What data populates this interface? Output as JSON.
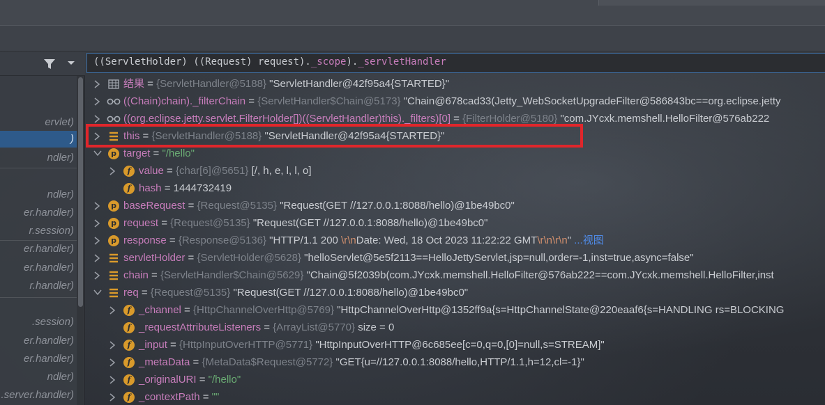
{
  "expression": {
    "part1": "((ServletHolder) ((Request) request).",
    "field1": "_scope",
    "part2": ").",
    "field2": "_servletHandler"
  },
  "frames": {
    "items": [
      {
        "label": "ervlet)"
      },
      {
        "label": ")"
      },
      {
        "label": "ndler)"
      },
      {
        "label": "ndler)"
      },
      {
        "label": "er.handler)"
      },
      {
        "label": "r.session)"
      },
      {
        "label": "er.handler)"
      },
      {
        "label": "er.handler)"
      },
      {
        "label": "r.handler)"
      },
      {
        "label": ".session)"
      },
      {
        "label": "er.handler)"
      },
      {
        "label": "er.handler)"
      },
      {
        "label": "ndler)"
      },
      {
        "label": ".server.handler)"
      }
    ]
  },
  "rows": [
    {
      "name": "结果",
      "type": "{ServletHandler@5188}",
      "value": "\"ServletHandler@42f95a4{STARTED}\""
    },
    {
      "name": "((Chain)chain)._filterChain",
      "type": "{ServletHandler$Chain@5173}",
      "value": "\"Chain@678cad33(Jetty_WebSocketUpgradeFilter@586843bc==org.eclipse.jetty"
    },
    {
      "name": "((org.eclipse.jetty.servlet.FilterHolder[])((ServletHandler)this)._filters)[0]",
      "type": "{FilterHolder@5180}",
      "value": "\"com.JYcxk.memshell.HelloFilter@576ab222"
    },
    {
      "name": "this",
      "type": "{ServletHandler@5188}",
      "value": "\"ServletHandler@42f95a4{STARTED}\""
    },
    {
      "name": "target",
      "value": "\"/hello\""
    },
    {
      "name": "value",
      "type": "{char[6]@5651}",
      "value": "[/, h, e, l, l, o]"
    },
    {
      "name": "hash",
      "value": "1444732419"
    },
    {
      "name": "baseRequest",
      "type": "{Request@5135}",
      "value": "\"Request(GET //127.0.0.1:8088/hello)@1be49bc0\""
    },
    {
      "name": "request",
      "type": "{Request@5135}",
      "value": "\"Request(GET //127.0.0.1:8088/hello)@1be49bc0\""
    },
    {
      "name": "response",
      "type": "{Response@5136}",
      "value_a": "\"HTTP/1.1 200 ",
      "esc_a": "\\r\\n",
      "value_b": "Date: Wed, 18 Oct 2023 11:22:22 GMT",
      "esc_b": "\\r\\n\\r\\n",
      "value_c": "\"",
      "link": "...视图"
    },
    {
      "name": "servletHolder",
      "type": "{ServletHolder@5628}",
      "value": "\"helloServlet@5e5f2113==HelloJettyServlet,jsp=null,order=-1,inst=true,async=false\""
    },
    {
      "name": "chain",
      "type": "{ServletHandler$Chain@5629}",
      "value": "\"Chain@5f2039b(com.JYcxk.memshell.HelloFilter@576ab222==com.JYcxk.memshell.HelloFilter,inst"
    },
    {
      "name": "req",
      "type": "{Request@5135}",
      "value": "\"Request(GET //127.0.0.1:8088/hello)@1be49bc0\""
    },
    {
      "name": "_channel",
      "type": "{HttpChannelOverHttp@5769}",
      "value": "\"HttpChannelOverHttp@1352ff9a{s=HttpChannelState@220eaaf6{s=HANDLING rs=BLOCKING"
    },
    {
      "name": "_requestAttributeListeners",
      "type": "{ArrayList@5770}",
      "value": " size = 0"
    },
    {
      "name": "_input",
      "type": "{HttpInputOverHTTP@5771}",
      "value": "\"HttpInputOverHTTP@6c685ee[c=0,q=0,[0]=null,s=STREAM]\""
    },
    {
      "name": "_metaData",
      "type": "{MetaData$Request@5772}",
      "value": "\"GET{u=//127.0.0.1:8088/hello,HTTP/1.1,h=12,cl=-1}\""
    },
    {
      "name": "_originalURI",
      "value": "\"/hello\""
    },
    {
      "name": "_contextPath",
      "value": "\"\""
    }
  ],
  "colors": {
    "accent": "#3f6fa4",
    "highlight": "#e0262b",
    "field_name": "#c77dbb",
    "type_hint": "#7d828a",
    "string_green": "#6aab73",
    "escape": "#cf8e6d",
    "link": "#4f8ae6"
  }
}
